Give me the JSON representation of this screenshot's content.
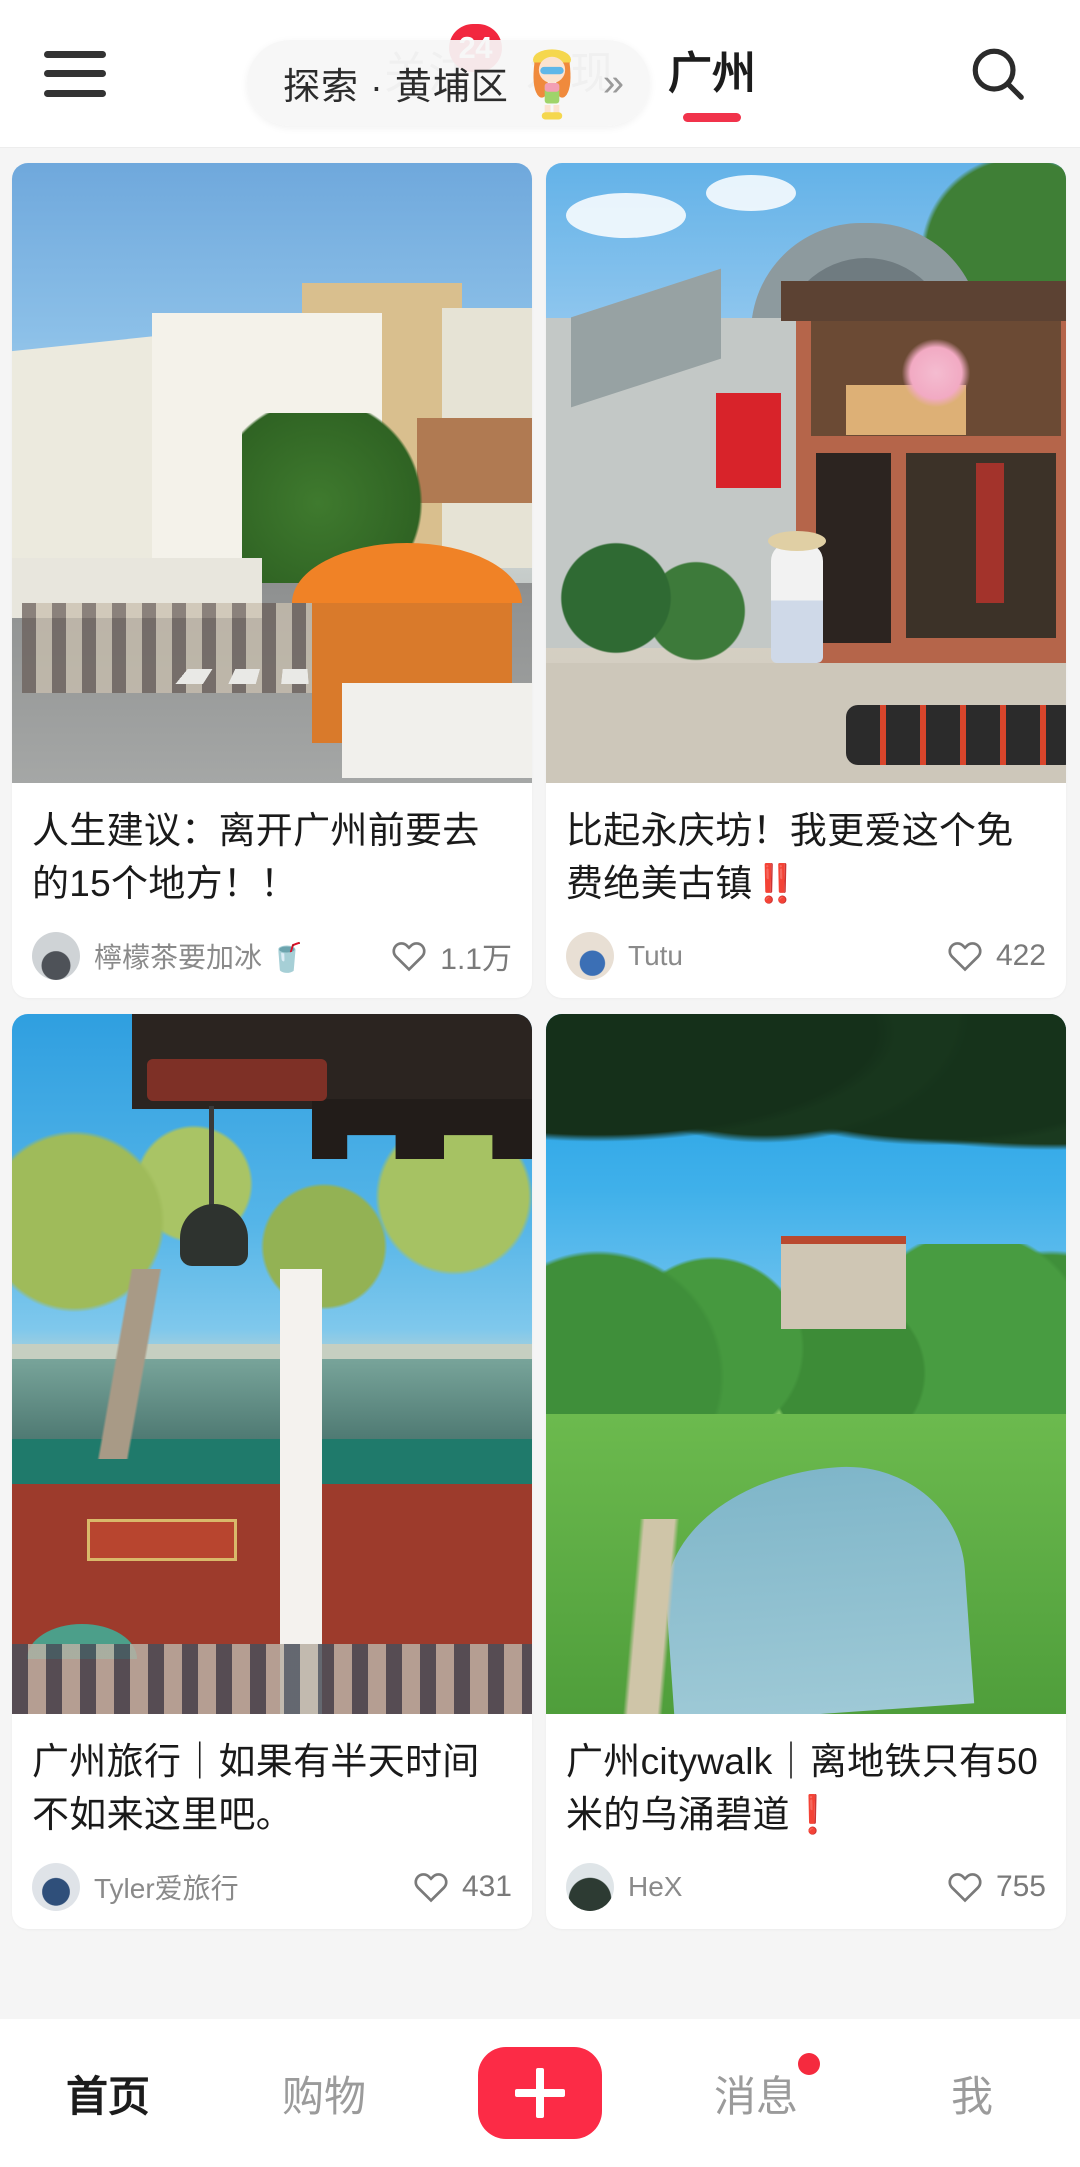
{
  "header": {
    "menu_icon": "hamburger-menu-icon",
    "search_icon": "search-icon",
    "tabs": [
      {
        "label": "关注",
        "badge": "24",
        "active": false
      },
      {
        "label": "发现",
        "badge": "",
        "active": false
      },
      {
        "label": "广州",
        "badge": "",
        "active": true
      }
    ]
  },
  "explore_pill": {
    "label": "探索 · 黄埔区",
    "chevron": "»",
    "mascot_icon": "mascot-girl-icon"
  },
  "colors": {
    "brand_red": "#fc2b46",
    "badge_red": "#f2273f",
    "tab_underline": "#f1334b",
    "active_text": "#1c1c1c",
    "inactive_text": "#9b9b9b",
    "page_background": "#f5f5f5",
    "card_background": "#ffffff"
  },
  "feed": {
    "columns": [
      {
        "cards": [
          {
            "title": "人生建议：离开广州前要去的15个地方！！",
            "author": "檸檬茶要加冰 🥤",
            "likes": "1.1万",
            "like_icon": "heart-outline-icon",
            "image_alt": "guangzhou-street-market-photo"
          },
          {
            "title": "广州旅行｜如果有半天时间不如来这里吧。",
            "author": "Tyler爱旅行",
            "likes": "431",
            "like_icon": "heart-outline-icon",
            "image_alt": "temple-bell-and-shrine-photo"
          }
        ]
      },
      {
        "cards": [
          {
            "title": "比起永庆坊！我更爱这个免费绝美古镇‼️",
            "author": "Tutu",
            "likes": "422",
            "like_icon": "heart-outline-icon",
            "image_alt": "ancient-town-lingnan-street-photo"
          },
          {
            "title": "广州citywalk｜离地铁只有50米的乌涌碧道❗",
            "author": "HeX",
            "likes": "755",
            "like_icon": "heart-outline-icon",
            "image_alt": "river-greenway-park-photo"
          }
        ]
      }
    ]
  },
  "bottom_nav": {
    "items": [
      {
        "label": "首页",
        "active": true,
        "dot": false
      },
      {
        "label": "购物",
        "active": false,
        "dot": false
      },
      {
        "label": "消息",
        "active": false,
        "dot": true
      },
      {
        "label": "我",
        "active": false,
        "dot": false
      }
    ],
    "publish_icon": "plus-icon"
  }
}
